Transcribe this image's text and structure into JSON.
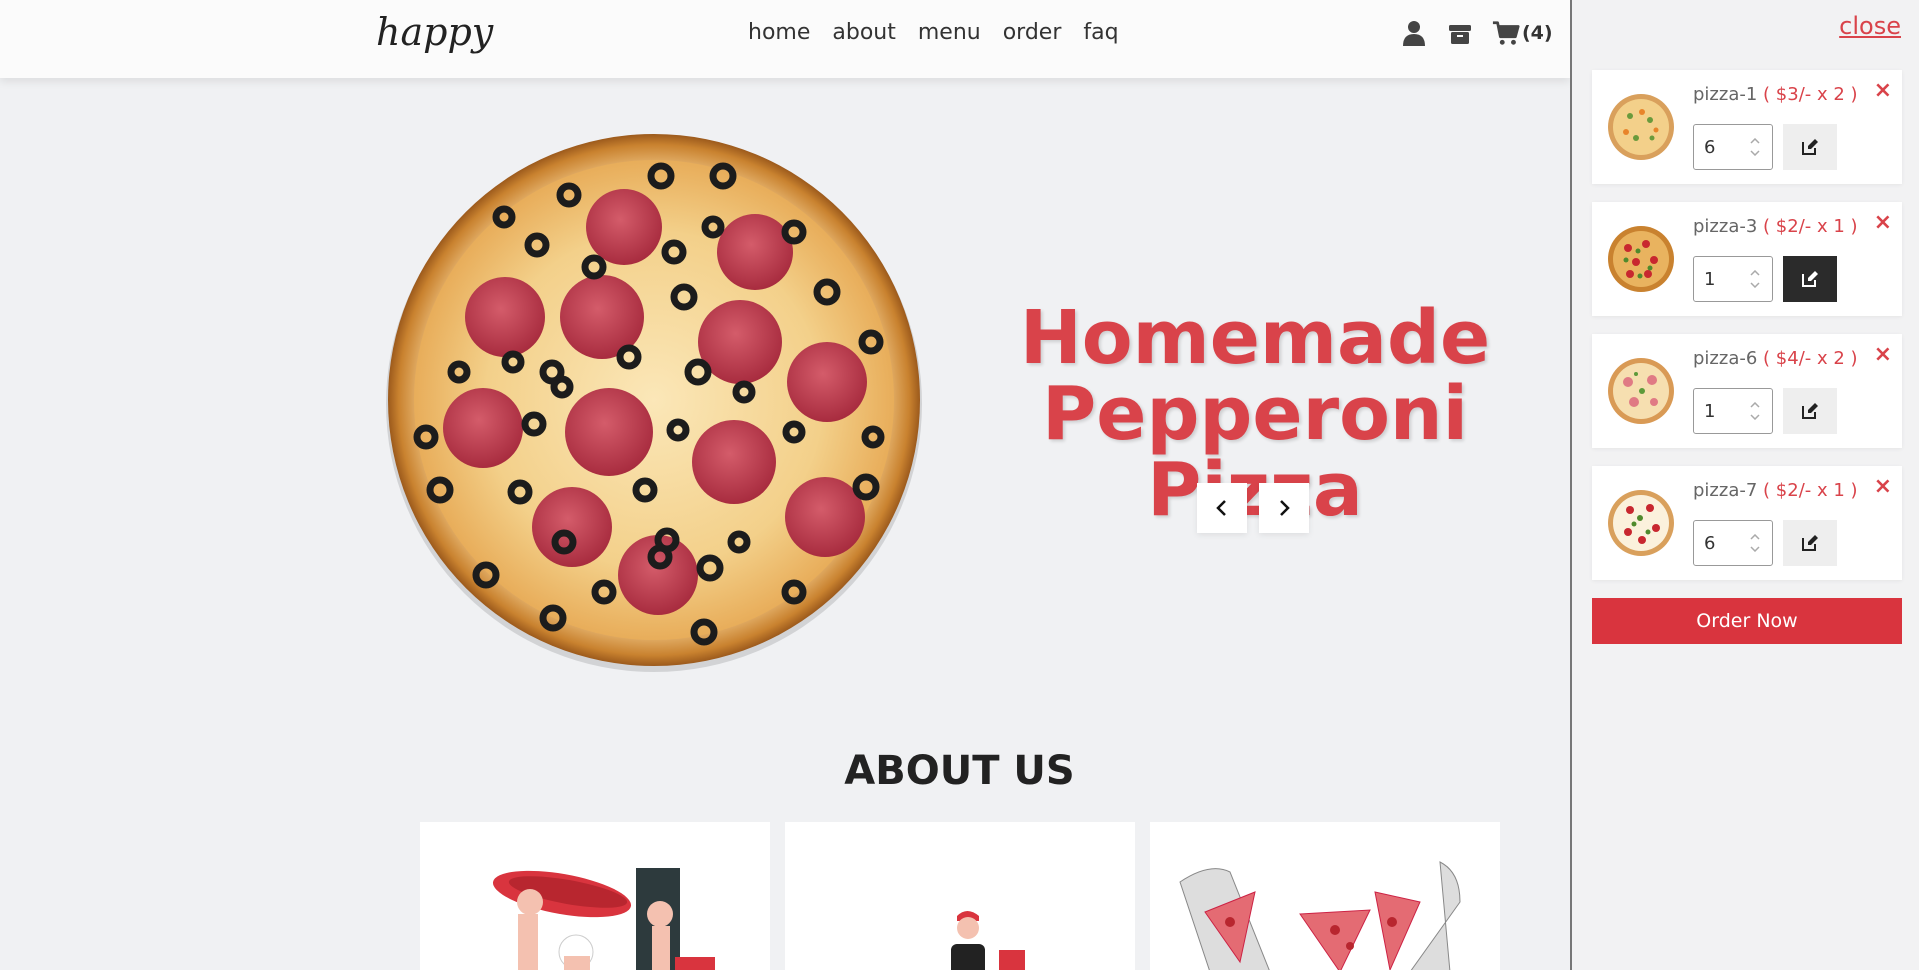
{
  "header": {
    "logo": "happy",
    "nav": [
      {
        "label": "home"
      },
      {
        "label": "about"
      },
      {
        "label": "menu"
      },
      {
        "label": "order"
      },
      {
        "label": "faq"
      }
    ],
    "icons": [
      "user-icon",
      "box-icon",
      "cart-icon"
    ],
    "cart_count": "(4)"
  },
  "hero": {
    "title_line1": "Homemade",
    "title_line2": "Pepperoni Pizza",
    "accent_color": "#d9434a"
  },
  "about": {
    "title": "ABOUT US"
  },
  "cart_panel": {
    "close_label": "close",
    "items": [
      {
        "name": "pizza-1",
        "price": "( $3/- x 2 )",
        "qty": "6"
      },
      {
        "name": "pizza-3",
        "price": "( $2/- x 1 )",
        "qty": "1"
      },
      {
        "name": "pizza-6",
        "price": "( $4/- x 2 )",
        "qty": "1"
      },
      {
        "name": "pizza-7",
        "price": "( $2/- x 1 )",
        "qty": "6"
      }
    ],
    "remove_symbol": "×",
    "order_button": "Order Now"
  }
}
